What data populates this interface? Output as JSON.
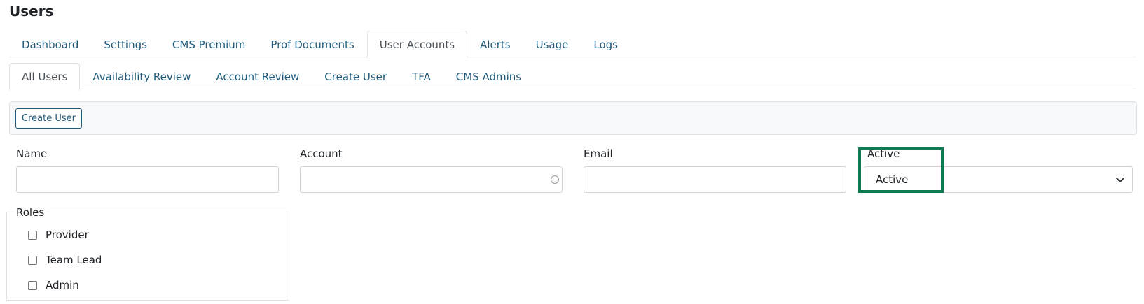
{
  "page": {
    "title": "Users"
  },
  "primary_tabs": [
    {
      "label": "Dashboard",
      "active": false
    },
    {
      "label": "Settings",
      "active": false
    },
    {
      "label": "CMS Premium",
      "active": false
    },
    {
      "label": "Prof Documents",
      "active": false
    },
    {
      "label": "User Accounts",
      "active": true
    },
    {
      "label": "Alerts",
      "active": false
    },
    {
      "label": "Usage",
      "active": false
    },
    {
      "label": "Logs",
      "active": false
    }
  ],
  "secondary_tabs": [
    {
      "label": "All Users",
      "active": true
    },
    {
      "label": "Availability Review",
      "active": false
    },
    {
      "label": "Account Review",
      "active": false
    },
    {
      "label": "Create User",
      "active": false
    },
    {
      "label": "TFA",
      "active": false
    },
    {
      "label": "CMS Admins",
      "active": false
    }
  ],
  "toolbar": {
    "create_user_label": "Create User"
  },
  "filters": {
    "name": {
      "label": "Name",
      "value": "",
      "placeholder": ""
    },
    "account": {
      "label": "Account",
      "value": "",
      "placeholder": ""
    },
    "email": {
      "label": "Email",
      "value": "",
      "placeholder": ""
    },
    "active": {
      "label": "Active",
      "selected": "Active"
    }
  },
  "roles": {
    "legend": "Roles",
    "items": [
      {
        "label": "Provider",
        "checked": false
      },
      {
        "label": "Team Lead",
        "checked": false
      },
      {
        "label": "Admin",
        "checked": false
      }
    ]
  },
  "colors": {
    "link": "#1f5a7a",
    "highlight": "#0e7a52",
    "border": "#dee2e6"
  }
}
